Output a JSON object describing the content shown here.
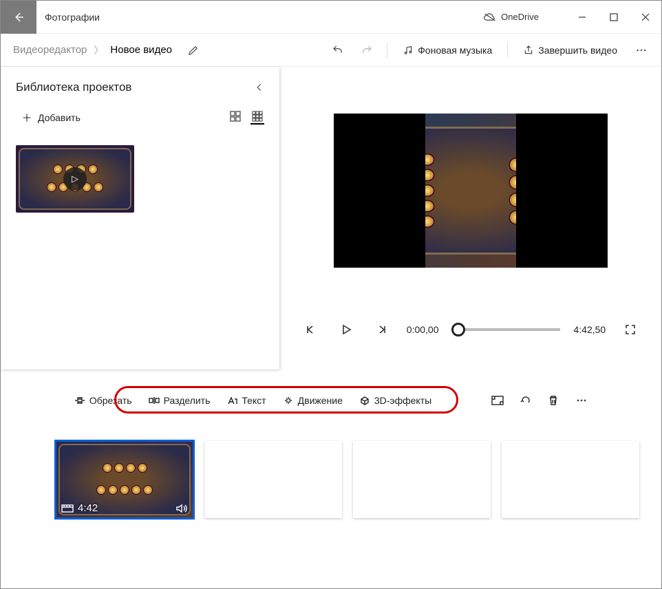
{
  "titlebar": {
    "app_name": "Фотографии",
    "onedrive": "OneDrive"
  },
  "breadcrumb": {
    "root": "Видеоредактор",
    "current": "Новое видео"
  },
  "commands": {
    "bg_music": "Фоновая музыка",
    "finish_video": "Завершить видео"
  },
  "library": {
    "title": "Библиотека проектов",
    "add_label": "Добавить"
  },
  "player": {
    "cur_time": "0:00,00",
    "total_time": "4:42,50"
  },
  "storyboard": {
    "tools": {
      "trim": "Обрезать",
      "split": "Разделить",
      "text": "Текст",
      "motion": "Движение",
      "effects3d": "3D-эффекты"
    },
    "clip_duration": "4:42"
  }
}
